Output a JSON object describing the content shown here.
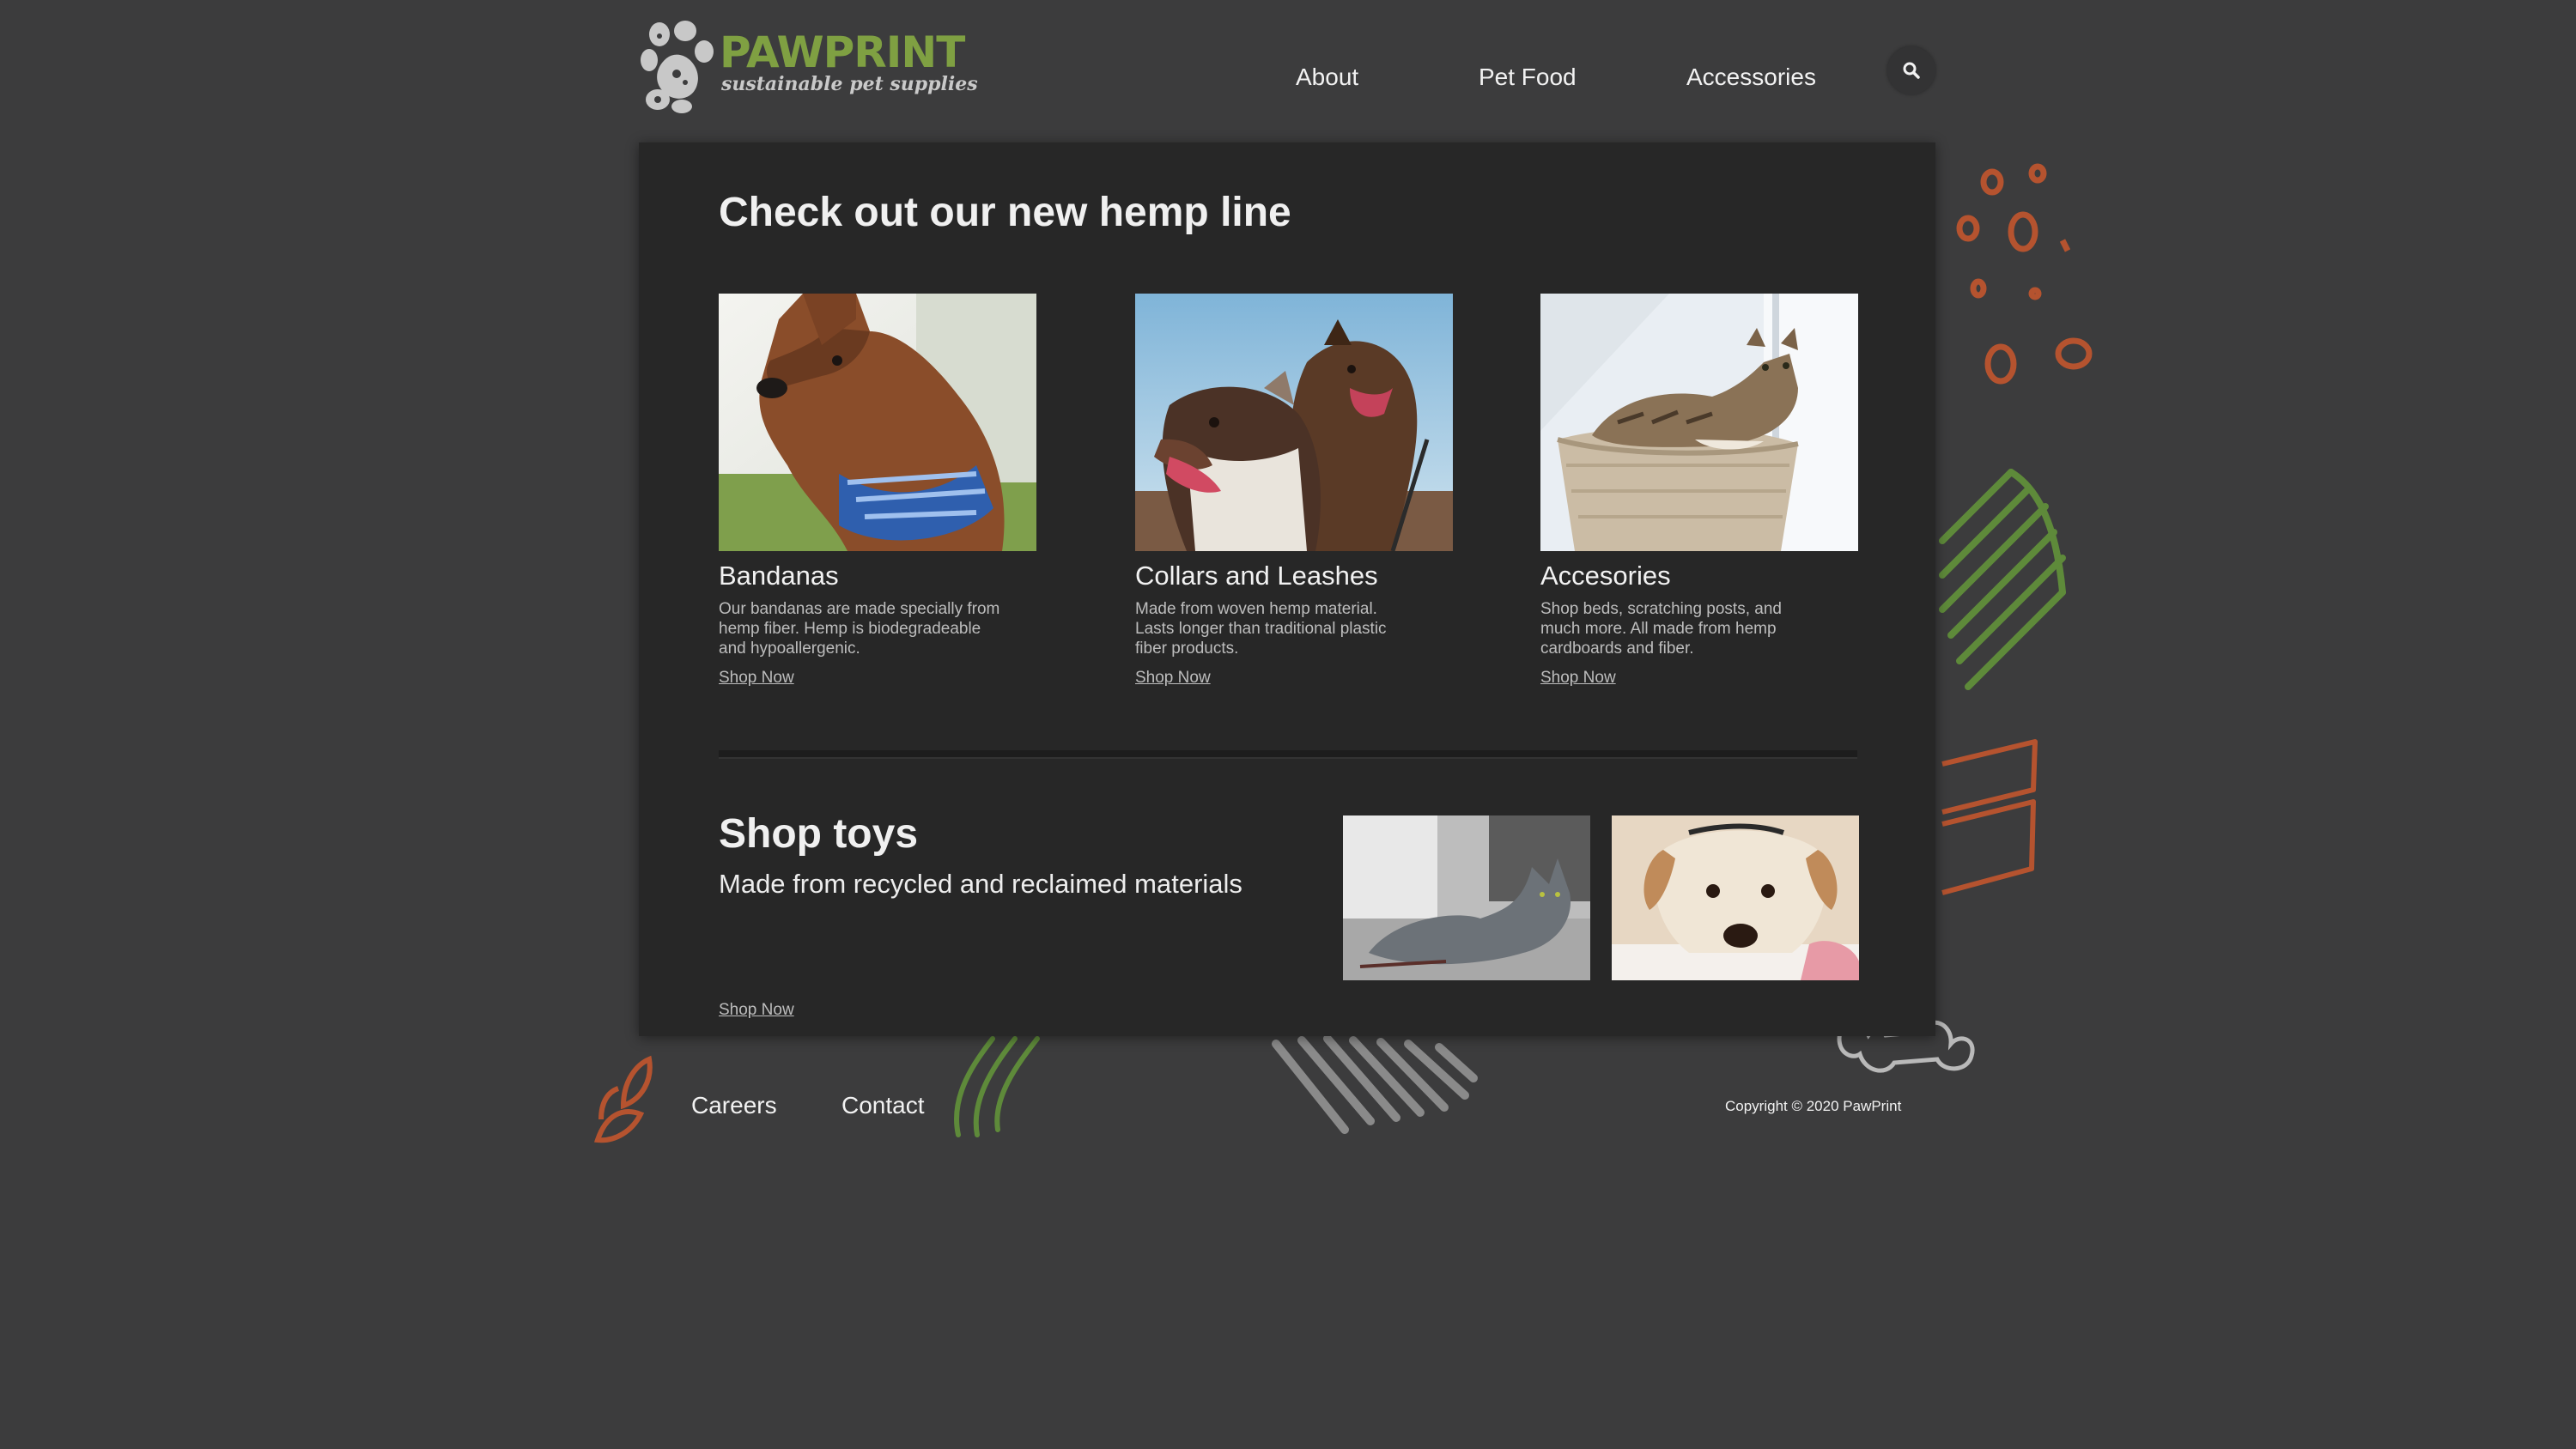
{
  "header": {
    "brand": "PAWPRINT",
    "tagline": "sustainable pet supplies",
    "nav": [
      "About",
      "Pet Food",
      "Accessories"
    ]
  },
  "hemp": {
    "title": "Check out our new hemp line",
    "products": [
      {
        "name": "Bandanas",
        "description": "Our bandanas are made specially from hemp fiber. Hemp is biodegradeable and hypoallergenic.",
        "link": "Shop Now"
      },
      {
        "name": "Collars and Leashes",
        "description": "Made from woven hemp material. Lasts longer than traditional plastic fiber products.",
        "link": "Shop Now"
      },
      {
        "name": "Accesories",
        "description": "Shop beds, scratching posts, and much more. All made from hemp cardboards and fiber.",
        "link": "Shop Now"
      }
    ]
  },
  "toys": {
    "title": "Shop toys",
    "subtitle": "Made from recycled and reclaimed materials",
    "link": "Shop Now"
  },
  "footer": {
    "links": [
      "Careers",
      "Contact"
    ],
    "copyright": "Copyright © 2020 PawPrint"
  },
  "colors": {
    "background": "#3c3c3d",
    "card": "#272727",
    "brand_green": "#7fa042",
    "accent_orange": "#b5532f",
    "deco_green": "#5e8a3a",
    "deco_gray": "#8a8a8a"
  },
  "icons": [
    "paw-logo-icon",
    "search-icon"
  ]
}
